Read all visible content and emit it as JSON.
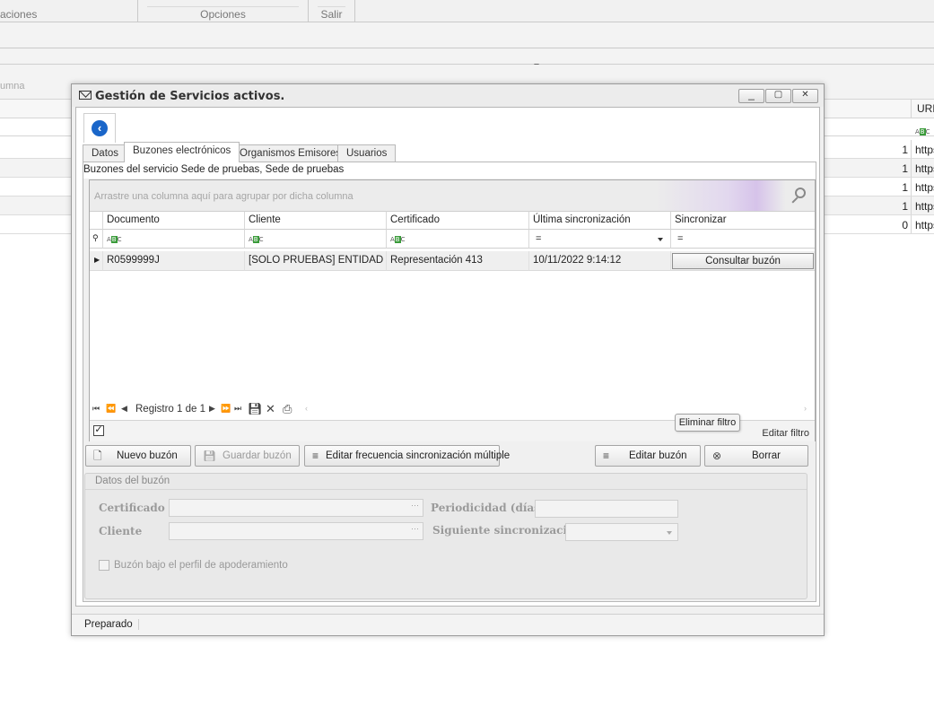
{
  "background": {
    "ribbon_groups": [
      "aciones",
      "Opciones",
      "Salir"
    ],
    "group_hint": "umna",
    "url_header": "URL",
    "rows": [
      {
        "count": "1",
        "url": "https"
      },
      {
        "count": "1",
        "url": "https"
      },
      {
        "count": "1",
        "url": "https"
      },
      {
        "count": "1",
        "url": "https"
      },
      {
        "count": "0",
        "url": "https"
      }
    ]
  },
  "dialog": {
    "title": "Gestión de Servicios activos.",
    "window_buttons": [
      "_",
      "▢",
      "✕"
    ],
    "tabs": [
      "Datos",
      "Buzones electrónicos",
      "Organismos Emisores",
      "Usuarios"
    ],
    "active_tab": "Buzones electrónicos",
    "service_label": "Buzones del servicio Sede de pruebas, Sede de pruebas",
    "grid": {
      "group_hint": "Arrastre una columna aquí para agrupar por dicha columna",
      "columns": [
        "Documento",
        "Cliente",
        "Certificado",
        "Última sincronización",
        "Sincronizar"
      ],
      "filter_abc": "ABC",
      "filter_eq": "=",
      "rows": [
        {
          "documento": "R0599999J",
          "cliente": "[SOLO PRUEBAS] ENTIDAD",
          "certificado": "Representación 413",
          "ultima": "10/11/2022 9:14:12",
          "sincronizar": "Consultar buzón"
        }
      ],
      "navigator": {
        "text": "Registro 1 de 1"
      },
      "tooltip": "Eliminar filtro",
      "edit_filter": "Editar filtro"
    },
    "buttons": {
      "nuevo": "Nuevo buzón",
      "guardar": "Guardar buzón",
      "editar_frecuencia": "Editar frecuencia sincronización múltiple",
      "editar": "Editar buzón",
      "borrar": "Borrar"
    },
    "datos": {
      "header": "Datos del buzón",
      "certificado_label": "Certificado",
      "cliente_label": "Cliente",
      "periodicidad_label": "Periodicidad (días)",
      "siguiente_label": "Siguiente sincronización",
      "checkbox_label": "Buzón bajo el perfil de apoderamiento"
    },
    "status": "Preparado"
  }
}
